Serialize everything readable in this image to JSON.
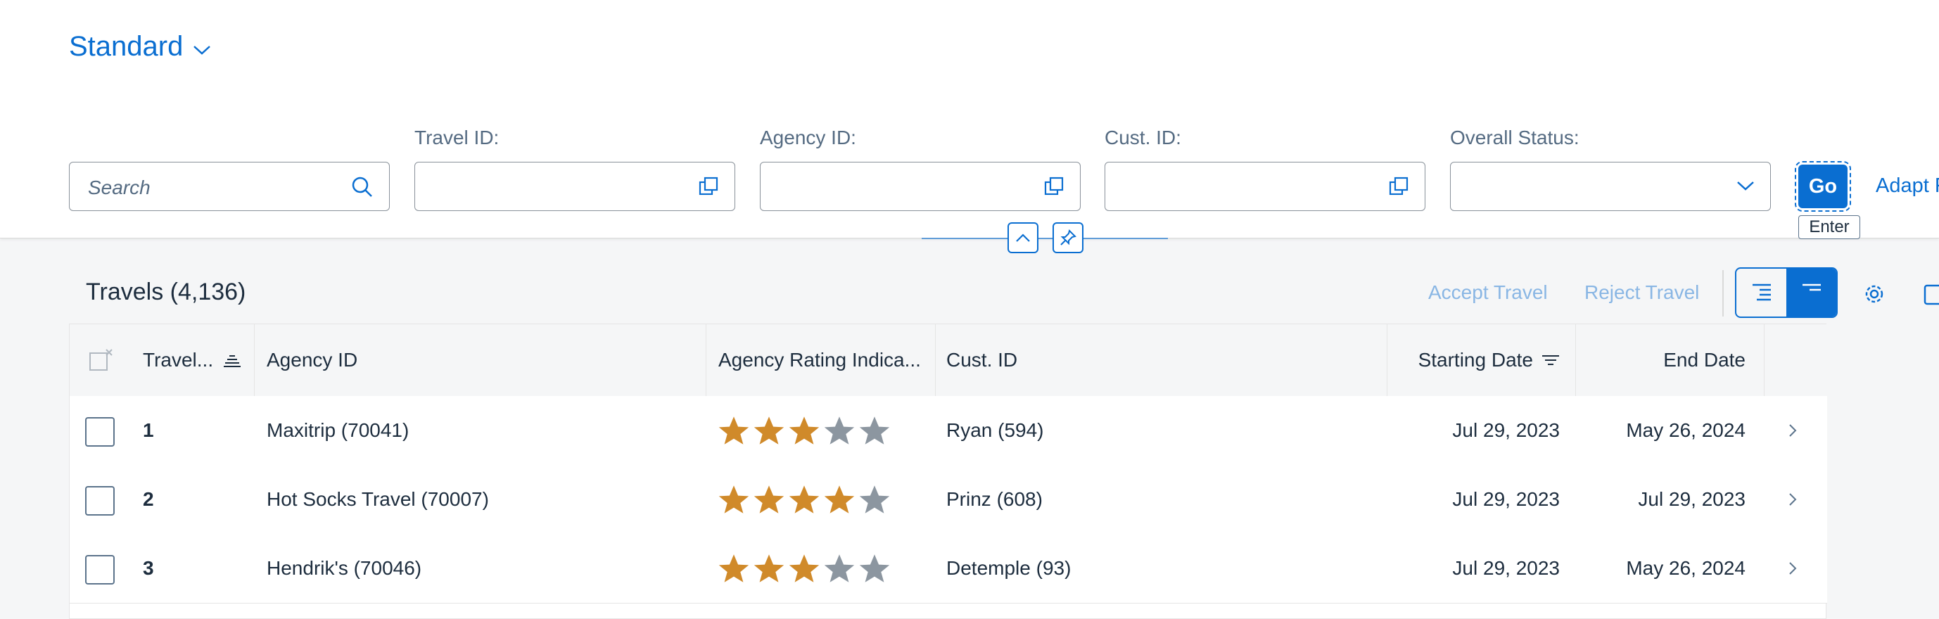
{
  "variant": {
    "label": "Standard"
  },
  "filters": {
    "search_placeholder": "Search",
    "travel_id_label": "Travel ID:",
    "agency_id_label": "Agency ID:",
    "cust_id_label": "Cust. ID:",
    "overall_status_label": "Overall Status:",
    "go_label": "Go",
    "go_tooltip": "Enter",
    "adapt_label": "Adapt F"
  },
  "table": {
    "title": "Travels (4,136)",
    "actions": {
      "accept": "Accept Travel",
      "reject": "Reject Travel"
    },
    "columns": {
      "travel": "Travel...",
      "agency_id": "Agency ID",
      "rating": "Agency Rating Indica...",
      "cust_id": "Cust. ID",
      "start": "Starting Date",
      "end": "End Date"
    },
    "rows": [
      {
        "travel": "1",
        "agency": "Maxitrip (70041)",
        "rating": 3,
        "cust": "Ryan (594)",
        "start": "Jul 29, 2023",
        "end": "May 26, 2024"
      },
      {
        "travel": "2",
        "agency": "Hot Socks Travel (70007)",
        "rating": 4,
        "cust": "Prinz (608)",
        "start": "Jul 29, 2023",
        "end": "Jul 29, 2023"
      },
      {
        "travel": "3",
        "agency": "Hendrik's (70046)",
        "rating": 3,
        "cust": "Detemple (93)",
        "start": "Jul 29, 2023",
        "end": "May 26, 2024"
      }
    ]
  },
  "colors": {
    "accent": "#0a6ed1",
    "star_filled": "#d08a2a",
    "star_empty": "#8c96a0"
  },
  "icons": [
    "chevron-down-icon",
    "search-icon",
    "value-help-icon",
    "collapse-icon",
    "pin-icon",
    "gear-icon",
    "export-icon",
    "sort-icon",
    "filter-icon",
    "chevron-right-icon",
    "star-icon"
  ]
}
